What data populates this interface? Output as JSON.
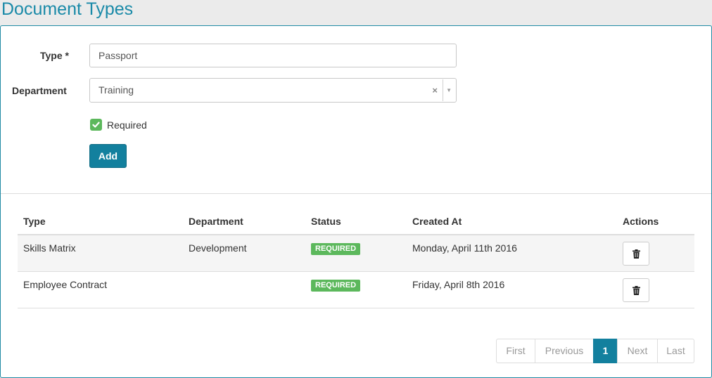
{
  "page_title": "Document Types",
  "form": {
    "type_label": "Type *",
    "type_value": "Passport",
    "department_label": "Department",
    "department_value": "Training",
    "department_clear": "×",
    "department_arrow": "▼",
    "required_label": "Required",
    "required_checked": true,
    "add_label": "Add"
  },
  "table": {
    "headers": [
      "Type",
      "Department",
      "Status",
      "Created At",
      "Actions"
    ],
    "rows": [
      {
        "type": "Skills Matrix",
        "department": "Development",
        "status": "REQUIRED",
        "created_at": "Monday, April 11th 2016"
      },
      {
        "type": "Employee Contract",
        "department": "",
        "status": "REQUIRED",
        "created_at": "Friday, April 8th 2016"
      }
    ]
  },
  "pagination": {
    "first": "First",
    "previous": "Previous",
    "current": "1",
    "next": "Next",
    "last": "Last"
  },
  "colors": {
    "accent": "#13809e",
    "success": "#5cb85c",
    "title": "#1a8aa8"
  },
  "icons": {
    "checkbox": "check-icon",
    "delete": "trash-icon"
  }
}
